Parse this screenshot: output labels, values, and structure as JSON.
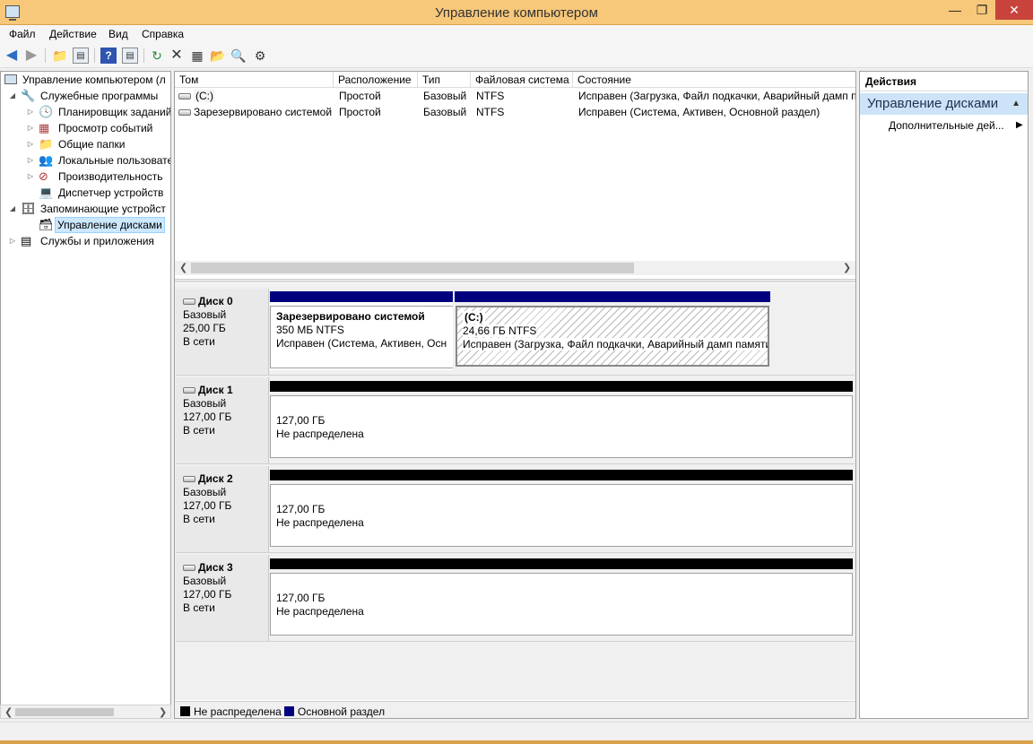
{
  "window": {
    "title": "Управление компьютером",
    "controls": {
      "minimize": "—",
      "maximize": "❐",
      "close": "✕"
    }
  },
  "menu": [
    "Файл",
    "Действие",
    "Вид",
    "Справка"
  ],
  "toolbar": {
    "icons": [
      "back-icon",
      "forward-icon",
      "up-folder-icon",
      "show-hide-tree-icon",
      "help-icon",
      "show-hide-action-pane-icon",
      "refresh-icon",
      "delete-icon",
      "properties-icon",
      "open-folder-icon",
      "search-icon",
      "disk-settings-icon"
    ]
  },
  "tree": {
    "root": "Управление компьютером (л",
    "system_tools": "Служебные программы",
    "task_scheduler": "Планировщик заданий",
    "event_viewer": "Просмотр событий",
    "shared_folders": "Общие папки",
    "local_users": "Локальные пользовате",
    "performance": "Производительность",
    "device_manager": "Диспетчер устройств",
    "storage": "Запоминающие устройст",
    "disk_management": "Управление дисками",
    "services_apps": "Службы и приложения"
  },
  "volume_list": {
    "columns": [
      "Том",
      "Расположение",
      "Тип",
      "Файловая система",
      "Состояние"
    ],
    "rows": [
      {
        "volume": "(C:)",
        "layout": "Простой",
        "type": "Базовый",
        "fs": "NTFS",
        "status": "Исправен (Загрузка, Файл подкачки, Аварийный дамп п"
      },
      {
        "volume": "Зарезервировано системой",
        "layout": "Простой",
        "type": "Базовый",
        "fs": "NTFS",
        "status": "Исправен (Система, Активен, Основной раздел)"
      }
    ]
  },
  "disks": [
    {
      "name": "Диск 0",
      "type": "Базовый",
      "size": "25,00 ГБ",
      "state": "В сети",
      "partitions": [
        {
          "name": "Зарезервировано системой",
          "size_fs": "350 МБ NTFS",
          "status": "Исправен (Система, Активен, Осн"
        },
        {
          "name": "(C:)",
          "size_fs": "24,66 ГБ NTFS",
          "status": "Исправен (Загрузка, Файл подкачки, Аварийный дамп памяти"
        }
      ]
    },
    {
      "name": "Диск 1",
      "type": "Базовый",
      "size": "127,00 ГБ",
      "state": "В сети",
      "unallocated": {
        "size": "127,00 ГБ",
        "label": "Не распределена"
      }
    },
    {
      "name": "Диск 2",
      "type": "Базовый",
      "size": "127,00 ГБ",
      "state": "В сети",
      "unallocated": {
        "size": "127,00 ГБ",
        "label": "Не распределена"
      }
    },
    {
      "name": "Диск 3",
      "type": "Базовый",
      "size": "127,00 ГБ",
      "state": "В сети",
      "unallocated": {
        "size": "127,00 ГБ",
        "label": "Не распределена"
      }
    }
  ],
  "legend": {
    "unallocated": "Не распределена",
    "primary": "Основной раздел",
    "colors": {
      "unallocated": "#000000",
      "primary": "#00007f"
    }
  },
  "actions": {
    "header": "Действия",
    "section": "Управление дисками",
    "more": "Дополнительные дей..."
  }
}
